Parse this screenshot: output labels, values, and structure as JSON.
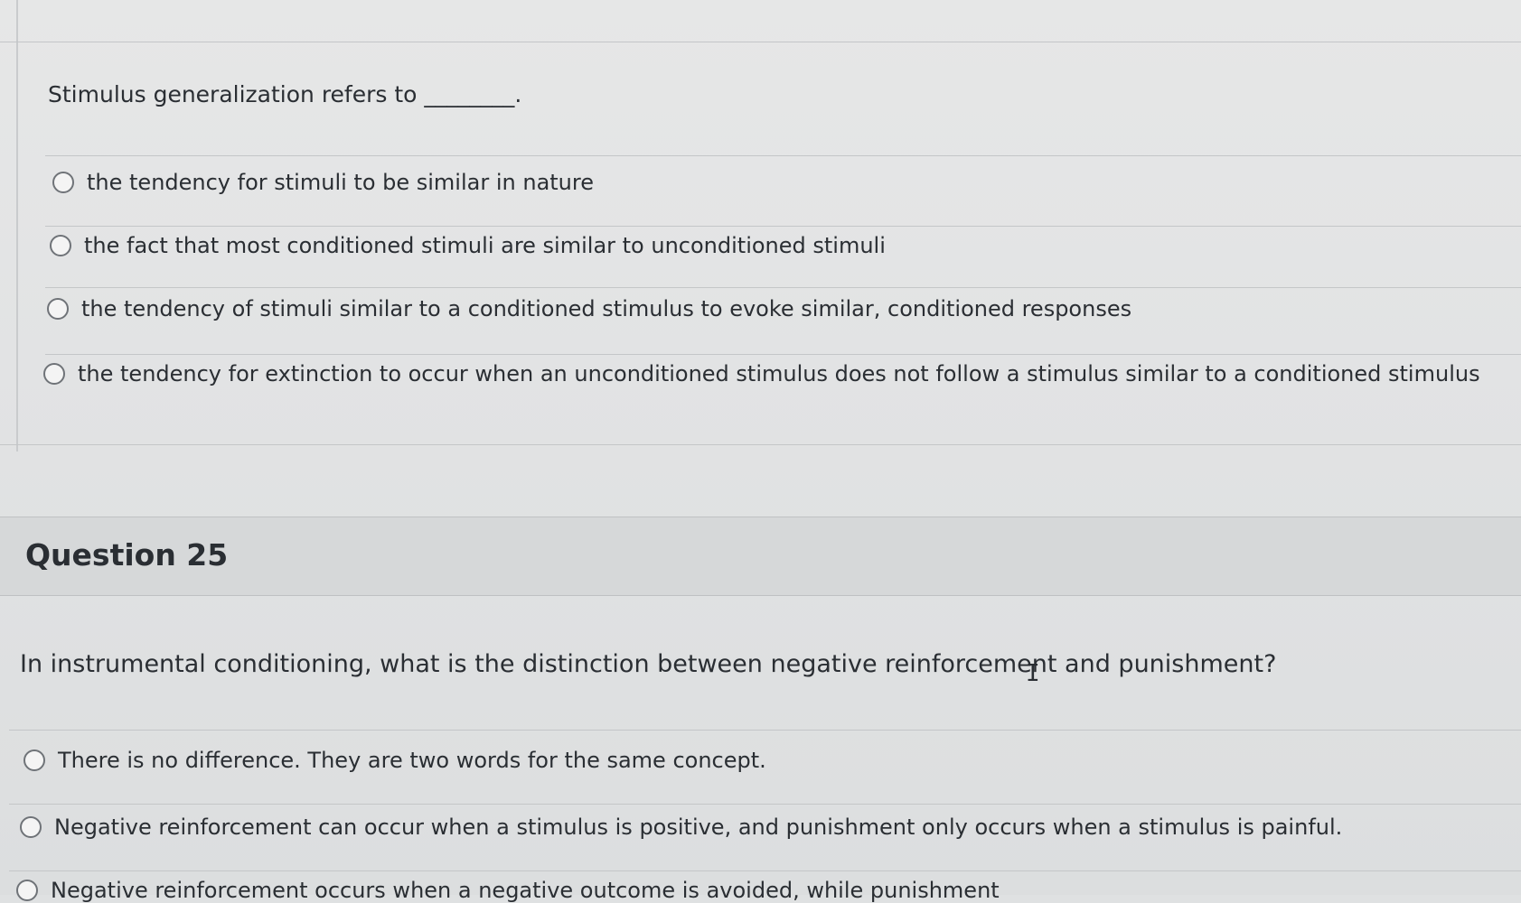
{
  "question_24": {
    "prompt": "Stimulus generalization refers to ________.",
    "options": [
      "the tendency for stimuli to be similar in nature",
      "the fact that most conditioned stimuli are similar to unconditioned stimuli",
      "the tendency of stimuli similar to a conditioned stimulus to evoke similar, conditioned responses",
      "the tendency for extinction to occur when an unconditioned stimulus does not follow a stimulus similar to a conditioned stimulus"
    ]
  },
  "question_25": {
    "title": "Question 25",
    "prompt": "In instrumental conditioning, what is the distinction between negative reinforcement and punishment?",
    "options": [
      "There is no difference. They are two words for the same concept.",
      "Negative reinforcement can occur when a stimulus is positive, and punishment only occurs when a stimulus is painful.",
      "Negative reinforcement occurs when a negative outcome is avoided, while punishment"
    ]
  },
  "cursor": {
    "glyph": "I"
  }
}
